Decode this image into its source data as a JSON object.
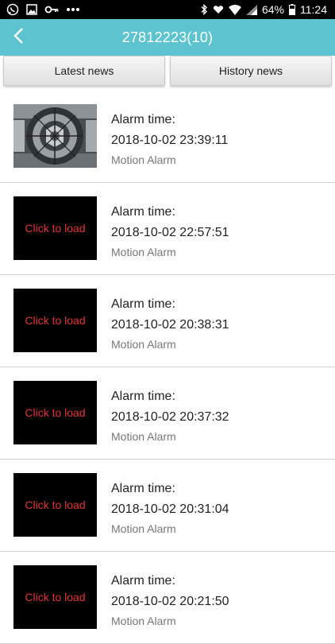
{
  "status_bar": {
    "battery": "64%",
    "time": "11:24",
    "icons": [
      "whatsapp-icon",
      "image-icon",
      "key-icon",
      "more-icon",
      "bluetooth-icon",
      "heart-icon",
      "wifi-icon",
      "signal-icon",
      "battery-icon"
    ]
  },
  "header": {
    "title": "27812223(10)"
  },
  "tabs": [
    {
      "label": "Latest news"
    },
    {
      "label": "History news"
    }
  ],
  "alarms": [
    {
      "label": "Alarm time:",
      "time": "2018-10-02 23:39:11",
      "type": "Motion Alarm",
      "thumb": "snapshot"
    },
    {
      "label": "Alarm time:",
      "time": "2018-10-02 22:57:51",
      "type": "Motion Alarm",
      "thumb_text": "Click to load"
    },
    {
      "label": "Alarm time:",
      "time": "2018-10-02 20:38:31",
      "type": "Motion Alarm",
      "thumb_text": "Click to load"
    },
    {
      "label": "Alarm time:",
      "time": "2018-10-02 20:37:32",
      "type": "Motion Alarm",
      "thumb_text": "Click to load"
    },
    {
      "label": "Alarm time:",
      "time": "2018-10-02 20:31:04",
      "type": "Motion Alarm",
      "thumb_text": "Click to load"
    },
    {
      "label": "Alarm time:",
      "time": "2018-10-02 20:21:50",
      "type": "Motion Alarm",
      "thumb_text": "Click to load"
    }
  ],
  "colors": {
    "appbar": "#5cc3cf",
    "click_to_load": "#e33434",
    "secondary_text": "#777777"
  }
}
